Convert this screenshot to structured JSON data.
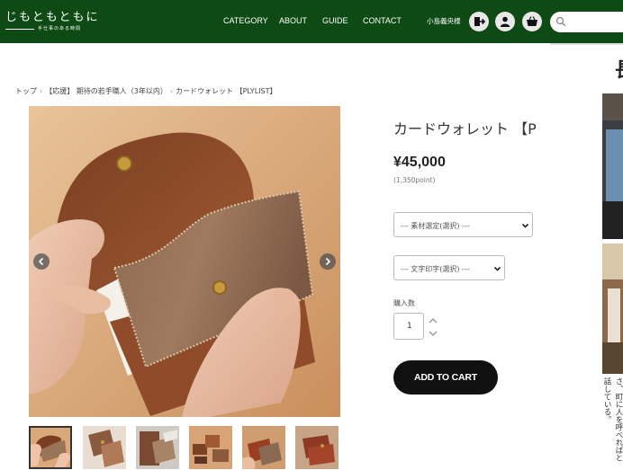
{
  "header": {
    "logo_title": "じもともともに",
    "logo_subtitle": "手仕事のある時間",
    "nav": [
      "CATEGORY",
      "ABOUT",
      "GUIDE",
      "CONTACT"
    ],
    "user_name": "小島義央様",
    "bg_color": "#0e4a14"
  },
  "breadcrumb": [
    "トップ",
    "【応援】 期待の若手職人（3年以内）",
    "カードウォレット 【PLYLIST】"
  ],
  "product": {
    "title": "カードウォレット 【P",
    "price": "¥45,000",
    "points": "(1,350point)",
    "select_material": "--- 素材選定(選択) ---",
    "select_print": "--- 文字印字(選択) ---",
    "quantity_label": "購入数",
    "quantity_value": "1",
    "add_to_cart": "ADD TO CART"
  },
  "icons": {
    "logout": "logout-icon",
    "user": "user-icon",
    "cart": "cart-icon",
    "search": "search-icon",
    "prev": "chevron-left-icon",
    "next": "chevron-right-icon",
    "stepper": "stepper-icon",
    "select": "chevron-down-icon"
  },
  "sidebar": {
    "heading": "長",
    "text_col1": "さ、町に人を呼べればと",
    "text_col2": "話している。"
  }
}
